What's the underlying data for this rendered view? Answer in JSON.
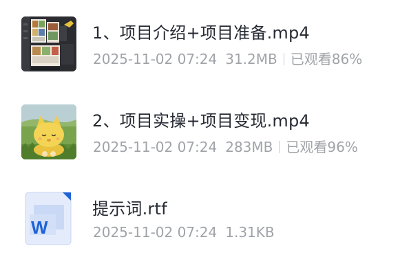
{
  "files": [
    {
      "name": "1、项目介绍+项目准备.mp4",
      "date": "2025-11-02 07:24",
      "size": "31.2MB",
      "progress": "已观看86%",
      "thumb_icon": "video-thumbnail-phone-screens-icon"
    },
    {
      "name": "2、项目实操+项目变现.mp4",
      "date": "2025-11-02 07:24",
      "size": "283MB",
      "progress": "已观看96%",
      "thumb_icon": "video-thumbnail-cartoon-cat-icon"
    },
    {
      "name": "提示词.rtf",
      "date": "2025-11-02 07:24",
      "size": "1.31KB",
      "thumb_icon": "word-document-icon"
    }
  ],
  "colors": {
    "name_text": "#262a33",
    "meta_text": "#a0a3a8",
    "word_blue": "#1e63d6"
  }
}
